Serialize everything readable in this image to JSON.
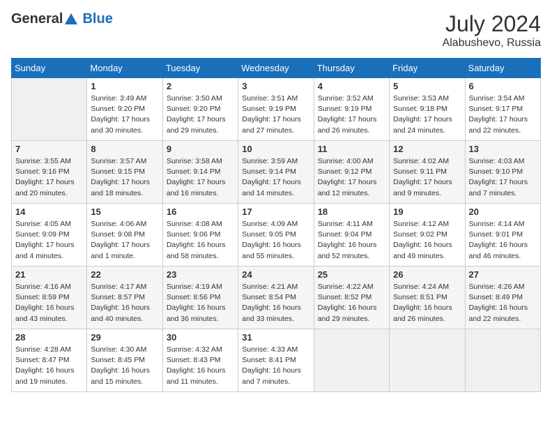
{
  "header": {
    "logo_general": "General",
    "logo_blue": "Blue",
    "month_year": "July 2024",
    "location": "Alabushevo, Russia"
  },
  "weekdays": [
    "Sunday",
    "Monday",
    "Tuesday",
    "Wednesday",
    "Thursday",
    "Friday",
    "Saturday"
  ],
  "weeks": [
    [
      {
        "day": "",
        "sunrise": "",
        "sunset": "",
        "daylight": ""
      },
      {
        "day": "1",
        "sunrise": "Sunrise: 3:49 AM",
        "sunset": "Sunset: 9:20 PM",
        "daylight": "Daylight: 17 hours and 30 minutes."
      },
      {
        "day": "2",
        "sunrise": "Sunrise: 3:50 AM",
        "sunset": "Sunset: 9:20 PM",
        "daylight": "Daylight: 17 hours and 29 minutes."
      },
      {
        "day": "3",
        "sunrise": "Sunrise: 3:51 AM",
        "sunset": "Sunset: 9:19 PM",
        "daylight": "Daylight: 17 hours and 27 minutes."
      },
      {
        "day": "4",
        "sunrise": "Sunrise: 3:52 AM",
        "sunset": "Sunset: 9:19 PM",
        "daylight": "Daylight: 17 hours and 26 minutes."
      },
      {
        "day": "5",
        "sunrise": "Sunrise: 3:53 AM",
        "sunset": "Sunset: 9:18 PM",
        "daylight": "Daylight: 17 hours and 24 minutes."
      },
      {
        "day": "6",
        "sunrise": "Sunrise: 3:54 AM",
        "sunset": "Sunset: 9:17 PM",
        "daylight": "Daylight: 17 hours and 22 minutes."
      }
    ],
    [
      {
        "day": "7",
        "sunrise": "Sunrise: 3:55 AM",
        "sunset": "Sunset: 9:16 PM",
        "daylight": "Daylight: 17 hours and 20 minutes."
      },
      {
        "day": "8",
        "sunrise": "Sunrise: 3:57 AM",
        "sunset": "Sunset: 9:15 PM",
        "daylight": "Daylight: 17 hours and 18 minutes."
      },
      {
        "day": "9",
        "sunrise": "Sunrise: 3:58 AM",
        "sunset": "Sunset: 9:14 PM",
        "daylight": "Daylight: 17 hours and 16 minutes."
      },
      {
        "day": "10",
        "sunrise": "Sunrise: 3:59 AM",
        "sunset": "Sunset: 9:14 PM",
        "daylight": "Daylight: 17 hours and 14 minutes."
      },
      {
        "day": "11",
        "sunrise": "Sunrise: 4:00 AM",
        "sunset": "Sunset: 9:12 PM",
        "daylight": "Daylight: 17 hours and 12 minutes."
      },
      {
        "day": "12",
        "sunrise": "Sunrise: 4:02 AM",
        "sunset": "Sunset: 9:11 PM",
        "daylight": "Daylight: 17 hours and 9 minutes."
      },
      {
        "day": "13",
        "sunrise": "Sunrise: 4:03 AM",
        "sunset": "Sunset: 9:10 PM",
        "daylight": "Daylight: 17 hours and 7 minutes."
      }
    ],
    [
      {
        "day": "14",
        "sunrise": "Sunrise: 4:05 AM",
        "sunset": "Sunset: 9:09 PM",
        "daylight": "Daylight: 17 hours and 4 minutes."
      },
      {
        "day": "15",
        "sunrise": "Sunrise: 4:06 AM",
        "sunset": "Sunset: 9:08 PM",
        "daylight": "Daylight: 17 hours and 1 minute."
      },
      {
        "day": "16",
        "sunrise": "Sunrise: 4:08 AM",
        "sunset": "Sunset: 9:06 PM",
        "daylight": "Daylight: 16 hours and 58 minutes."
      },
      {
        "day": "17",
        "sunrise": "Sunrise: 4:09 AM",
        "sunset": "Sunset: 9:05 PM",
        "daylight": "Daylight: 16 hours and 55 minutes."
      },
      {
        "day": "18",
        "sunrise": "Sunrise: 4:11 AM",
        "sunset": "Sunset: 9:04 PM",
        "daylight": "Daylight: 16 hours and 52 minutes."
      },
      {
        "day": "19",
        "sunrise": "Sunrise: 4:12 AM",
        "sunset": "Sunset: 9:02 PM",
        "daylight": "Daylight: 16 hours and 49 minutes."
      },
      {
        "day": "20",
        "sunrise": "Sunrise: 4:14 AM",
        "sunset": "Sunset: 9:01 PM",
        "daylight": "Daylight: 16 hours and 46 minutes."
      }
    ],
    [
      {
        "day": "21",
        "sunrise": "Sunrise: 4:16 AM",
        "sunset": "Sunset: 8:59 PM",
        "daylight": "Daylight: 16 hours and 43 minutes."
      },
      {
        "day": "22",
        "sunrise": "Sunrise: 4:17 AM",
        "sunset": "Sunset: 8:57 PM",
        "daylight": "Daylight: 16 hours and 40 minutes."
      },
      {
        "day": "23",
        "sunrise": "Sunrise: 4:19 AM",
        "sunset": "Sunset: 8:56 PM",
        "daylight": "Daylight: 16 hours and 36 minutes."
      },
      {
        "day": "24",
        "sunrise": "Sunrise: 4:21 AM",
        "sunset": "Sunset: 8:54 PM",
        "daylight": "Daylight: 16 hours and 33 minutes."
      },
      {
        "day": "25",
        "sunrise": "Sunrise: 4:22 AM",
        "sunset": "Sunset: 8:52 PM",
        "daylight": "Daylight: 16 hours and 29 minutes."
      },
      {
        "day": "26",
        "sunrise": "Sunrise: 4:24 AM",
        "sunset": "Sunset: 8:51 PM",
        "daylight": "Daylight: 16 hours and 26 minutes."
      },
      {
        "day": "27",
        "sunrise": "Sunrise: 4:26 AM",
        "sunset": "Sunset: 8:49 PM",
        "daylight": "Daylight: 16 hours and 22 minutes."
      }
    ],
    [
      {
        "day": "28",
        "sunrise": "Sunrise: 4:28 AM",
        "sunset": "Sunset: 8:47 PM",
        "daylight": "Daylight: 16 hours and 19 minutes."
      },
      {
        "day": "29",
        "sunrise": "Sunrise: 4:30 AM",
        "sunset": "Sunset: 8:45 PM",
        "daylight": "Daylight: 16 hours and 15 minutes."
      },
      {
        "day": "30",
        "sunrise": "Sunrise: 4:32 AM",
        "sunset": "Sunset: 8:43 PM",
        "daylight": "Daylight: 16 hours and 11 minutes."
      },
      {
        "day": "31",
        "sunrise": "Sunrise: 4:33 AM",
        "sunset": "Sunset: 8:41 PM",
        "daylight": "Daylight: 16 hours and 7 minutes."
      },
      {
        "day": "",
        "sunrise": "",
        "sunset": "",
        "daylight": ""
      },
      {
        "day": "",
        "sunrise": "",
        "sunset": "",
        "daylight": ""
      },
      {
        "day": "",
        "sunrise": "",
        "sunset": "",
        "daylight": ""
      }
    ]
  ]
}
